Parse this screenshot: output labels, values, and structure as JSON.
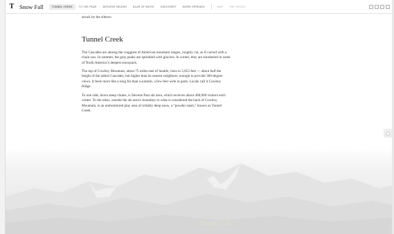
{
  "header": {
    "logo": "T",
    "story_title": "Snow Fall",
    "nav": [
      {
        "label": "TUNNEL CREEK",
        "active": true
      },
      {
        "label": "TO THE PEAK",
        "active": false
      },
      {
        "label": "DESCENT BEGINS",
        "active": false
      },
      {
        "label": "BLUR OF WHITE",
        "active": false
      },
      {
        "label": "DISCOVERY",
        "active": false
      },
      {
        "label": "WORD SPREADS",
        "active": false
      }
    ],
    "secondary_nav": [
      {
        "label": "MAP"
      },
      {
        "label": "THE GROUP"
      }
    ],
    "tools": [
      "comment-icon",
      "share-icon",
      "email-icon",
      "print-icon"
    ]
  },
  "article": {
    "lead_tail": "struck by the silence.",
    "section_heading": "Tunnel Creek",
    "paragraphs": [
      "The Cascades are among the craggiest of American mountain ranges, roughly cut, as if carved with a chain saw. In summer, the gray peaks are sprinkled with glaciers. In winter, they are smothered in some of North America’s deepest snowpack.",
      "The top of Cowboy Mountain, about 75 miles east of Seattle, rises to 5,853 feet — about half the height of the tallest Cascades, but higher than its nearest neighbors, enough to provide 360-degree views. It feels more like a long fin than a summit, a few feet wide in parts. Locals call it Cowboy Ridge.",
      "To one side, down steep chutes, is Stevens Pass ski area, which receives about 400,000 visitors each winter. To the other, outside the ski area’s boundary to what is considered the back of Cowboy Mountain, is an unmonitored play area of reliably deep snow, a “powder stash,” known as Tunnel Creek."
    ]
  },
  "hero": {
    "caption": "Tunnel Creek",
    "title": "Tunnel Creek"
  },
  "colors": {
    "nav_active_bg": "#ececec",
    "text": "#333333",
    "hero_bg": "#e8e8e8"
  }
}
